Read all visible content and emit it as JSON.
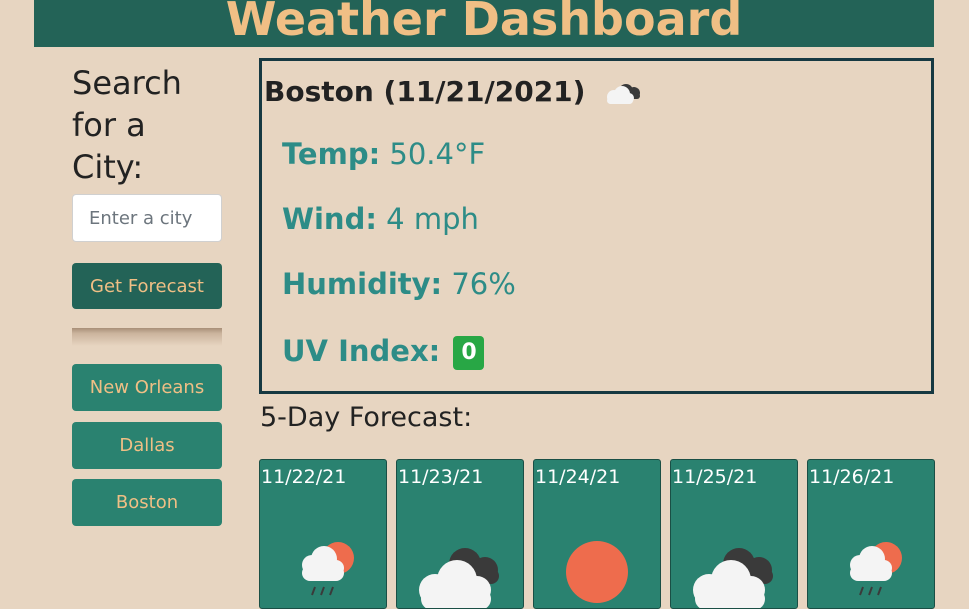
{
  "header": {
    "title": "Weather Dashboard"
  },
  "sidebar": {
    "heading": "Search for a City:",
    "search_placeholder": "Enter a city",
    "search_value": "",
    "forecast_button": "Get Forecast",
    "history": [
      {
        "label": "New Orleans"
      },
      {
        "label": "Dallas"
      },
      {
        "label": "Boston"
      }
    ]
  },
  "current": {
    "title": "Boston (11/21/2021)",
    "icon": "cloudy-icon",
    "temp_label": "Temp:",
    "temp_value": "50.4°F",
    "wind_label": "Wind:",
    "wind_value": "4 mph",
    "humidity_label": "Humidity:",
    "humidity_value": "76%",
    "uv_label": "UV Index:",
    "uv_value": "0",
    "uv_color": "#28a745"
  },
  "forecast": {
    "heading": "5-Day Forecast:",
    "days": [
      {
        "date": "11/22/21",
        "icon": "rain-sun-icon"
      },
      {
        "date": "11/23/21",
        "icon": "cloudy-icon"
      },
      {
        "date": "11/24/21",
        "icon": "sun-icon"
      },
      {
        "date": "11/25/21",
        "icon": "cloudy-icon"
      },
      {
        "date": "11/26/21",
        "icon": "rain-sun-icon"
      }
    ]
  },
  "colors": {
    "background": "#e7d5c1",
    "header": "#236357",
    "accent_text": "#f0bf85",
    "button": "#2a8270",
    "stat_text": "#2d8c87"
  }
}
